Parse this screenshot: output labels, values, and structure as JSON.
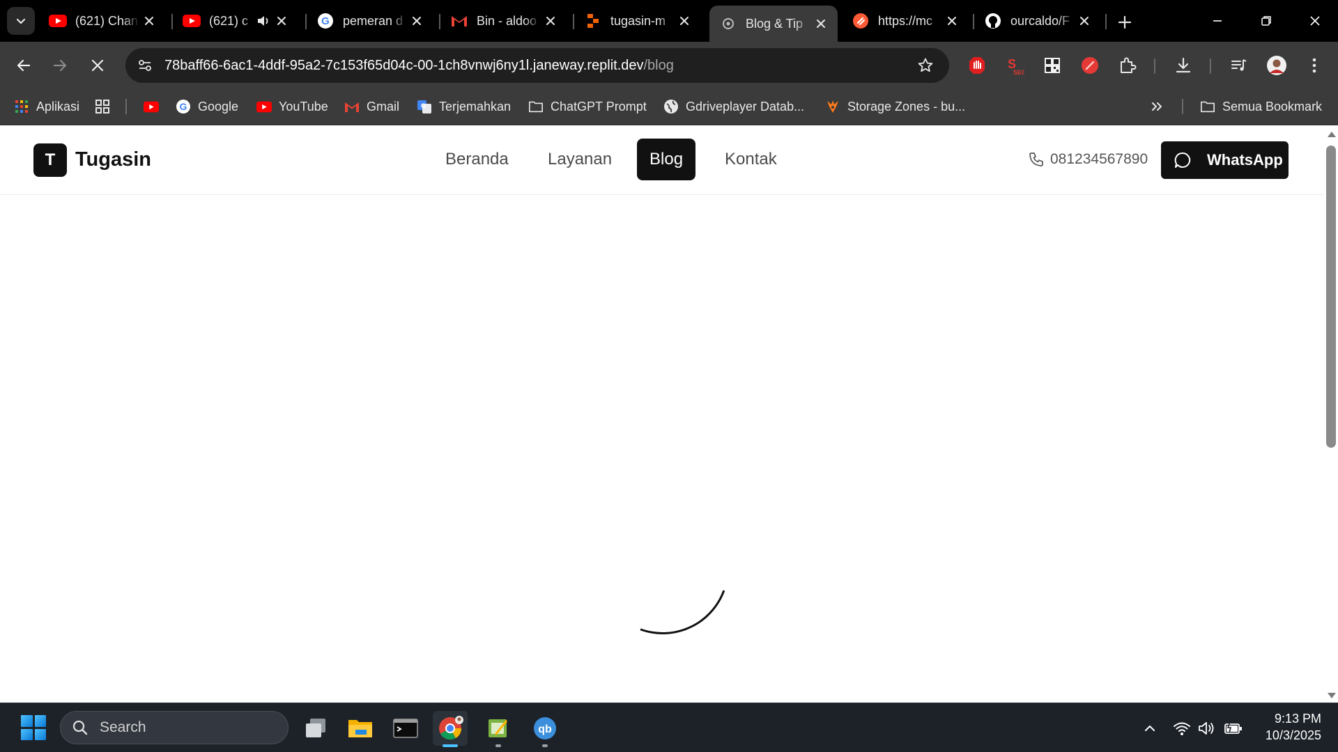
{
  "browser": {
    "tabs": [
      {
        "title": "(621) Chan",
        "icon": "youtube-icon",
        "has_audio": false
      },
      {
        "title": "(621) c",
        "icon": "youtube-icon",
        "has_audio": true
      },
      {
        "title": "pemeran d",
        "icon": "google-icon",
        "has_audio": false
      },
      {
        "title": "Bin - aldoo",
        "icon": "gmail-icon",
        "has_audio": false
      },
      {
        "title": "tugasin-m",
        "icon": "replit-icon",
        "has_audio": false
      },
      {
        "title": "Blog & Tip",
        "icon": "loading-globe-icon",
        "has_audio": false,
        "active": true
      },
      {
        "title": "https://mc",
        "icon": "orange-app-icon",
        "has_audio": false
      },
      {
        "title": "ourcaldo/F",
        "icon": "github-icon",
        "has_audio": false
      }
    ],
    "address_bar": {
      "url_host": "78baff66-6ac1-4ddf-95a2-7c153f65d04c-00-1ch8vnwj6ny1l.janeway.replit.dev",
      "url_path": "/blog"
    },
    "bookmarks": [
      {
        "label": "Aplikasi",
        "icon": "apps-grid-icon"
      },
      {
        "label": "",
        "icon": "grid-icon"
      },
      {
        "label": "",
        "icon": "youtube-icon"
      },
      {
        "label": "Google",
        "icon": "google-icon"
      },
      {
        "label": "YouTube",
        "icon": "youtube-icon"
      },
      {
        "label": "Gmail",
        "icon": "gmail-icon"
      },
      {
        "label": "Terjemahkan",
        "icon": "translate-icon"
      },
      {
        "label": "ChatGPT Prompt",
        "icon": "folder-icon"
      },
      {
        "label": "Gdriveplayer Datab...",
        "icon": "globe-icon"
      },
      {
        "label": "Storage Zones - bu...",
        "icon": "bunny-icon"
      }
    ],
    "all_bookmarks_label": "Semua Bookmark"
  },
  "site": {
    "logo_letter": "T",
    "logo_text": "Tugasin",
    "nav": [
      {
        "label": "Beranda",
        "active": false
      },
      {
        "label": "Layanan",
        "active": false
      },
      {
        "label": "Blog",
        "active": true
      },
      {
        "label": "Kontak",
        "active": false
      }
    ],
    "phone": "081234567890",
    "whatsapp_label": "WhatsApp"
  },
  "taskbar": {
    "search_placeholder": "Search",
    "time": "9:13 PM",
    "date": "10/3/2025"
  },
  "colors": {
    "accent_dark": "#111111",
    "chrome_toolbar": "#3b3b3b",
    "taskbar_bg": "#1d2229"
  }
}
